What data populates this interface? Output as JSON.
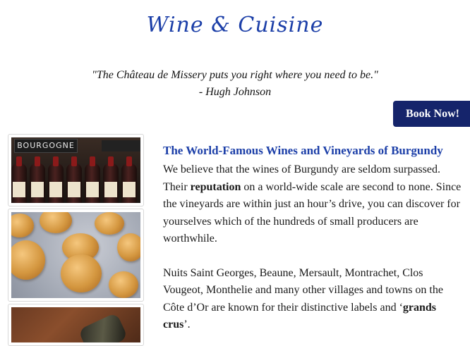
{
  "header": {
    "title": "Wine & Cuisine"
  },
  "quote": {
    "text": "\"The Château de Missery puts you right where you need to be.\"",
    "author": "- Hugh Johnson"
  },
  "book_button": {
    "label": "Book Now!"
  },
  "images": [
    {
      "icon": "wine-rack-photo",
      "sign_text": "BOURGOGNE"
    },
    {
      "icon": "gougeres-photo"
    },
    {
      "icon": "wine-bottle-photo"
    }
  ],
  "article": {
    "heading": "The World-Famous Wines and Vineyards of Burgundy",
    "p1_before": "We believe that the wines of Burgundy are seldom surpassed. Their ",
    "p1_bold": "reputation",
    "p1_after": " on a world-wide scale are second to none. Since the vineyards are within just an hour’s drive, you can discover for yourselves which of the hundreds of small producers are worthwhile.",
    "p2_before": "Nuits Saint Georges, Beaune, Mersault, Montrachet, Clos Vougeot, Monthelie and many other villages and towns on the Côte d’Or are known for their distinctive labels and ",
    "p2_quote_open": "‘",
    "p2_bold": "grands crus",
    "p2_after": "’."
  },
  "colors": {
    "title": "#1c3fa8",
    "heading": "#1c3fa8",
    "button_bg": "#15246b",
    "button_text": "#ffffff"
  }
}
